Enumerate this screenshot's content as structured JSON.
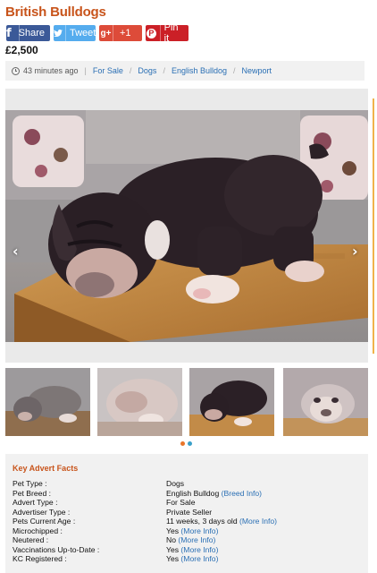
{
  "listing": {
    "title": "British Bulldogs",
    "price": "£2,500"
  },
  "share": {
    "facebook": {
      "label": "Share",
      "icon": "f"
    },
    "twitter": {
      "label": "Tweet",
      "icon": "twitter-bird-icon"
    },
    "google": {
      "label": "+1",
      "icon": "g+"
    },
    "pinterest": {
      "label": "Pin it",
      "icon": "P"
    }
  },
  "breadcrumb": {
    "time": "43 minutes ago",
    "items": [
      "For Sale",
      "Dogs",
      "English Bulldog",
      "Newport"
    ]
  },
  "gallery": {
    "prev_arrow": "‹",
    "next_arrow": "›",
    "thumbnail_count": 4,
    "active_dot": 0,
    "dot_colors": [
      "#e8752a",
      "#3aa0c9"
    ]
  },
  "facts": {
    "heading": "Key Advert Facts",
    "rows": [
      {
        "label": "Pet Type :",
        "value": "Dogs",
        "link": ""
      },
      {
        "label": "Pet Breed :",
        "value": "English Bulldog",
        "link": "(Breed Info)"
      },
      {
        "label": "Advert Type :",
        "value": "For Sale",
        "link": ""
      },
      {
        "label": "Advertiser Type :",
        "value": "Private Seller",
        "link": ""
      },
      {
        "label": "Pets Current Age :",
        "value": "11 weeks, 3 days old",
        "link": "(More Info)"
      },
      {
        "label": "Microchipped :",
        "value": "Yes",
        "link": "(More Info)"
      },
      {
        "label": "Neutered :",
        "value": "No",
        "link": "(More Info)"
      },
      {
        "label": "Vaccinations Up-to-Date :",
        "value": "Yes",
        "link": "(More Info)"
      },
      {
        "label": "KC Registered :",
        "value": "Yes",
        "link": "(More Info)"
      }
    ]
  },
  "colors": {
    "accent": "#c8541b",
    "link": "#2a6fb4",
    "facebook": "#3b5998",
    "twitter": "#55acee",
    "google": "#dd4b39",
    "pinterest": "#cb2027"
  }
}
